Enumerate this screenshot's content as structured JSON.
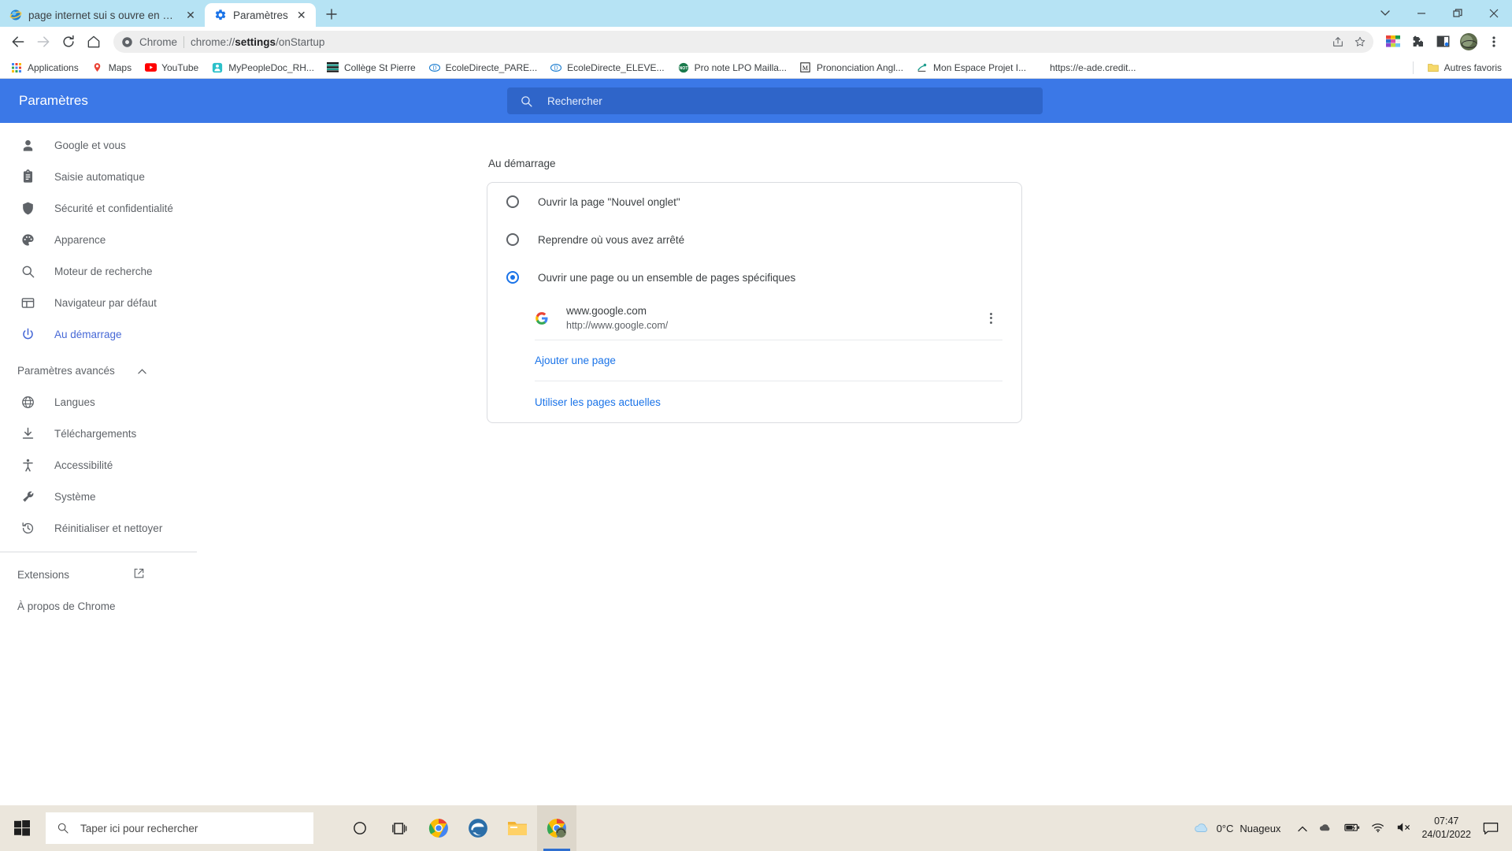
{
  "browser": {
    "tabs": [
      {
        "title": "page internet sui s ouvre en plus",
        "icon": "ie-icon",
        "active": false
      },
      {
        "title": "Paramètres",
        "icon": "gear-icon",
        "active": true
      }
    ],
    "new_tab_label": "+",
    "window_controls": {
      "tab_search": "⌄",
      "minimize": "—",
      "maximize": "❐",
      "close": "✕"
    },
    "omnibox": {
      "scheme_label": "Chrome",
      "url_prefix": "chrome://",
      "url_bold": "settings",
      "url_suffix": "/onStartup",
      "full_url": "chrome://settings/onStartup"
    },
    "bookmarks": [
      {
        "label": "Applications",
        "icon": "apps-grid-icon"
      },
      {
        "label": "Maps",
        "icon": "maps-pin-icon"
      },
      {
        "label": "YouTube",
        "icon": "youtube-icon"
      },
      {
        "label": "MyPeopleDoc_RH...",
        "icon": "mypeopledoc-icon"
      },
      {
        "label": "Collège St Pierre",
        "icon": "stripes-icon"
      },
      {
        "label": "EcoleDirecte_PARE...",
        "icon": "ecoledirecte-icon"
      },
      {
        "label": "EcoleDirecte_ELEVE...",
        "icon": "ecoledirecte-icon"
      },
      {
        "label": "Pro note LPO Mailla...",
        "icon": "pronote-icon"
      },
      {
        "label": "Prononciation Angl...",
        "icon": "macmillan-icon"
      },
      {
        "label": "Mon Espace Projet I...",
        "icon": "projet-icon"
      },
      {
        "label": "https://e-ade.credit...",
        "icon": "blank-icon"
      }
    ],
    "other_bookmarks_label": "Autres favoris"
  },
  "settings": {
    "title": "Paramètres",
    "search_placeholder": "Rechercher",
    "sidebar": {
      "items": [
        {
          "label": "Google et vous",
          "icon": "person-icon",
          "selected": false
        },
        {
          "label": "Saisie automatique",
          "icon": "clipboard-icon",
          "selected": false
        },
        {
          "label": "Sécurité et confidentialité",
          "icon": "shield-icon",
          "selected": false
        },
        {
          "label": "Apparence",
          "icon": "palette-icon",
          "selected": false
        },
        {
          "label": "Moteur de recherche",
          "icon": "search-icon",
          "selected": false
        },
        {
          "label": "Navigateur par défaut",
          "icon": "browser-window-icon",
          "selected": false
        },
        {
          "label": "Au démarrage",
          "icon": "power-icon",
          "selected": true
        }
      ],
      "advanced_label": "Paramètres avancés",
      "advanced_items": [
        {
          "label": "Langues",
          "icon": "globe-icon"
        },
        {
          "label": "Téléchargements",
          "icon": "download-icon"
        },
        {
          "label": "Accessibilité",
          "icon": "accessibility-icon"
        },
        {
          "label": "Système",
          "icon": "wrench-icon"
        },
        {
          "label": "Réinitialiser et nettoyer",
          "icon": "history-restore-icon"
        }
      ],
      "extensions_label": "Extensions",
      "about_label": "À propos de Chrome"
    },
    "main": {
      "section_title": "Au démarrage",
      "options": [
        {
          "label": "Ouvrir la page \"Nouvel onglet\"",
          "checked": false
        },
        {
          "label": "Reprendre où vous avez arrêté",
          "checked": false
        },
        {
          "label": "Ouvrir une page ou un ensemble de pages spécifiques",
          "checked": true
        }
      ],
      "startup_pages": [
        {
          "name": "www.google.com",
          "url": "http://www.google.com/",
          "icon": "google-g-icon"
        }
      ],
      "add_page_label": "Ajouter une page",
      "use_current_pages_label": "Utiliser les pages actuelles"
    }
  },
  "taskbar": {
    "search_placeholder": "Taper ici pour rechercher",
    "items": [
      {
        "name": "cortana-icon"
      },
      {
        "name": "task-view-icon"
      },
      {
        "name": "chrome-icon"
      },
      {
        "name": "edge-icon"
      },
      {
        "name": "file-explorer-icon"
      },
      {
        "name": "chrome-active-icon"
      }
    ],
    "weather": {
      "temp": "0°C",
      "condition": "Nuageux"
    },
    "clock": {
      "time": "07:47",
      "date": "24/01/2022"
    }
  },
  "colors": {
    "tabstrip": "#b6e3f4",
    "settings_header": "#3b78e7",
    "accent_blue": "#1a73e8",
    "sidebar_selected": "#4668d6",
    "taskbar": "#ebe6dc"
  }
}
